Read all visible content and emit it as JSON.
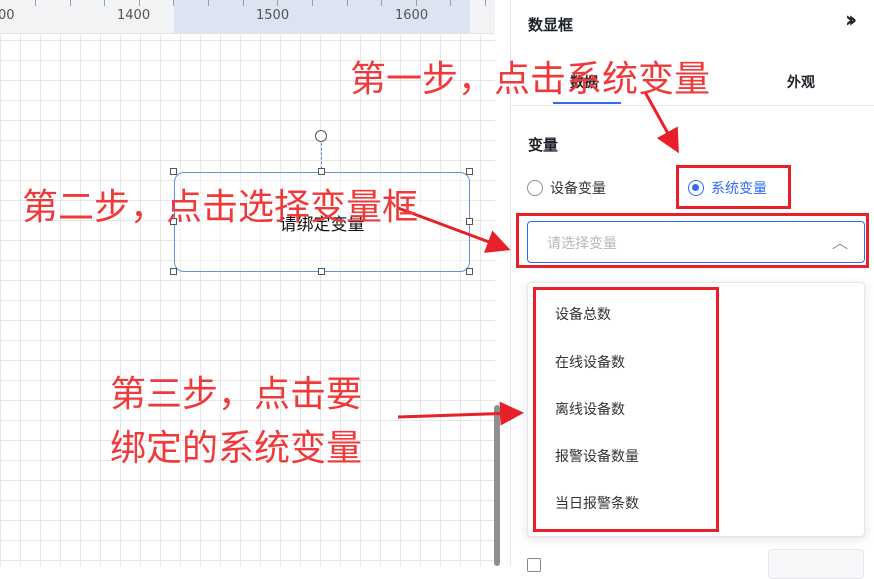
{
  "ruler": {
    "labels": [
      "00",
      "1400",
      "1500",
      "1600"
    ]
  },
  "canvas": {
    "widget_text": "请绑定变量"
  },
  "panel": {
    "title": "数显框",
    "collapse_icon": "chevron-double-right-icon",
    "tabs": [
      "数据",
      "外观"
    ],
    "active_tab": "数据",
    "section_label": "变量",
    "radio_device": "设备变量",
    "radio_system": "系统变量",
    "selected_radio": "系统变量",
    "select_placeholder": "请选择变量",
    "options": [
      "设备总数",
      "在线设备数",
      "离线设备数",
      "报警设备数量",
      "当日报警条数"
    ]
  },
  "annotations": {
    "step1": "第一步，点击系统变量",
    "step2": "第二步，点击选择变量框",
    "step3_line1": "第三步，点击要",
    "step3_line2": "绑定的系统变量"
  },
  "colors": {
    "accent": "#2f6bf2",
    "annotation": "#f0393a",
    "highlight_box": "#e8202a"
  }
}
